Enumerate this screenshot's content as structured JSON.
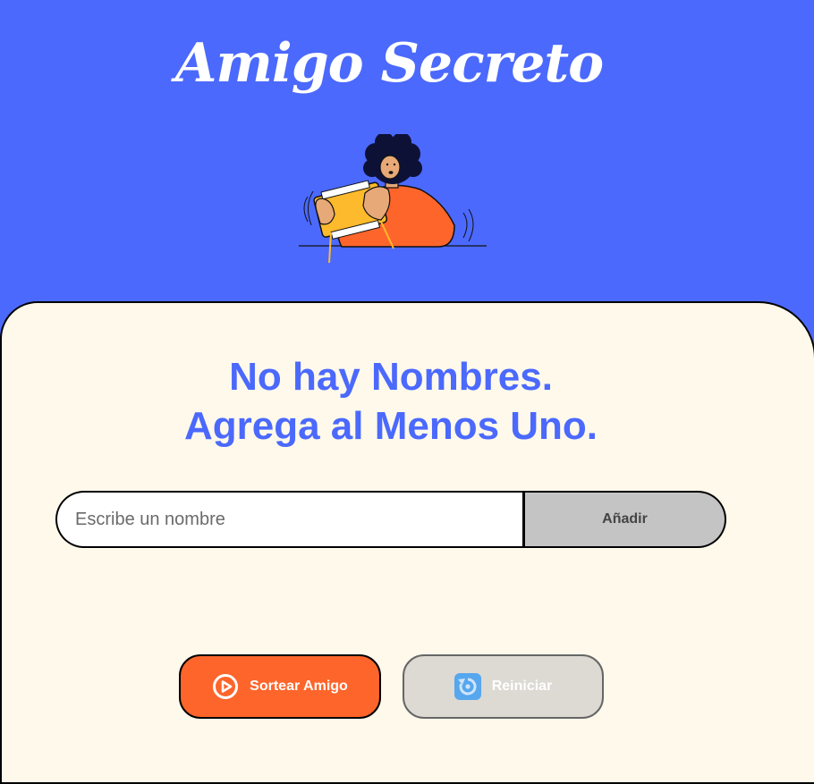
{
  "header": {
    "title": "Amigo Secreto",
    "illustration": "person-playing-handheld-console"
  },
  "main": {
    "heading_line1": "No hay Nombres.",
    "heading_line2": "Agrega al Menos Uno.",
    "name_input": {
      "value": "",
      "placeholder": "Escribe un nombre"
    },
    "add_label": "Añadir",
    "draw_label": "Sortear Amigo",
    "draw_icon": "play-circle-icon",
    "reset_label": "Reiniciar",
    "reset_icon": "reset-icon"
  },
  "colors": {
    "header_bg": "#4B69FD",
    "content_bg": "#FFF9EB",
    "accent": "#FE652B",
    "heading": "#4B69FD",
    "add_button_bg": "#C4C4C4",
    "reset_button_bg": "#DDD9D3"
  }
}
